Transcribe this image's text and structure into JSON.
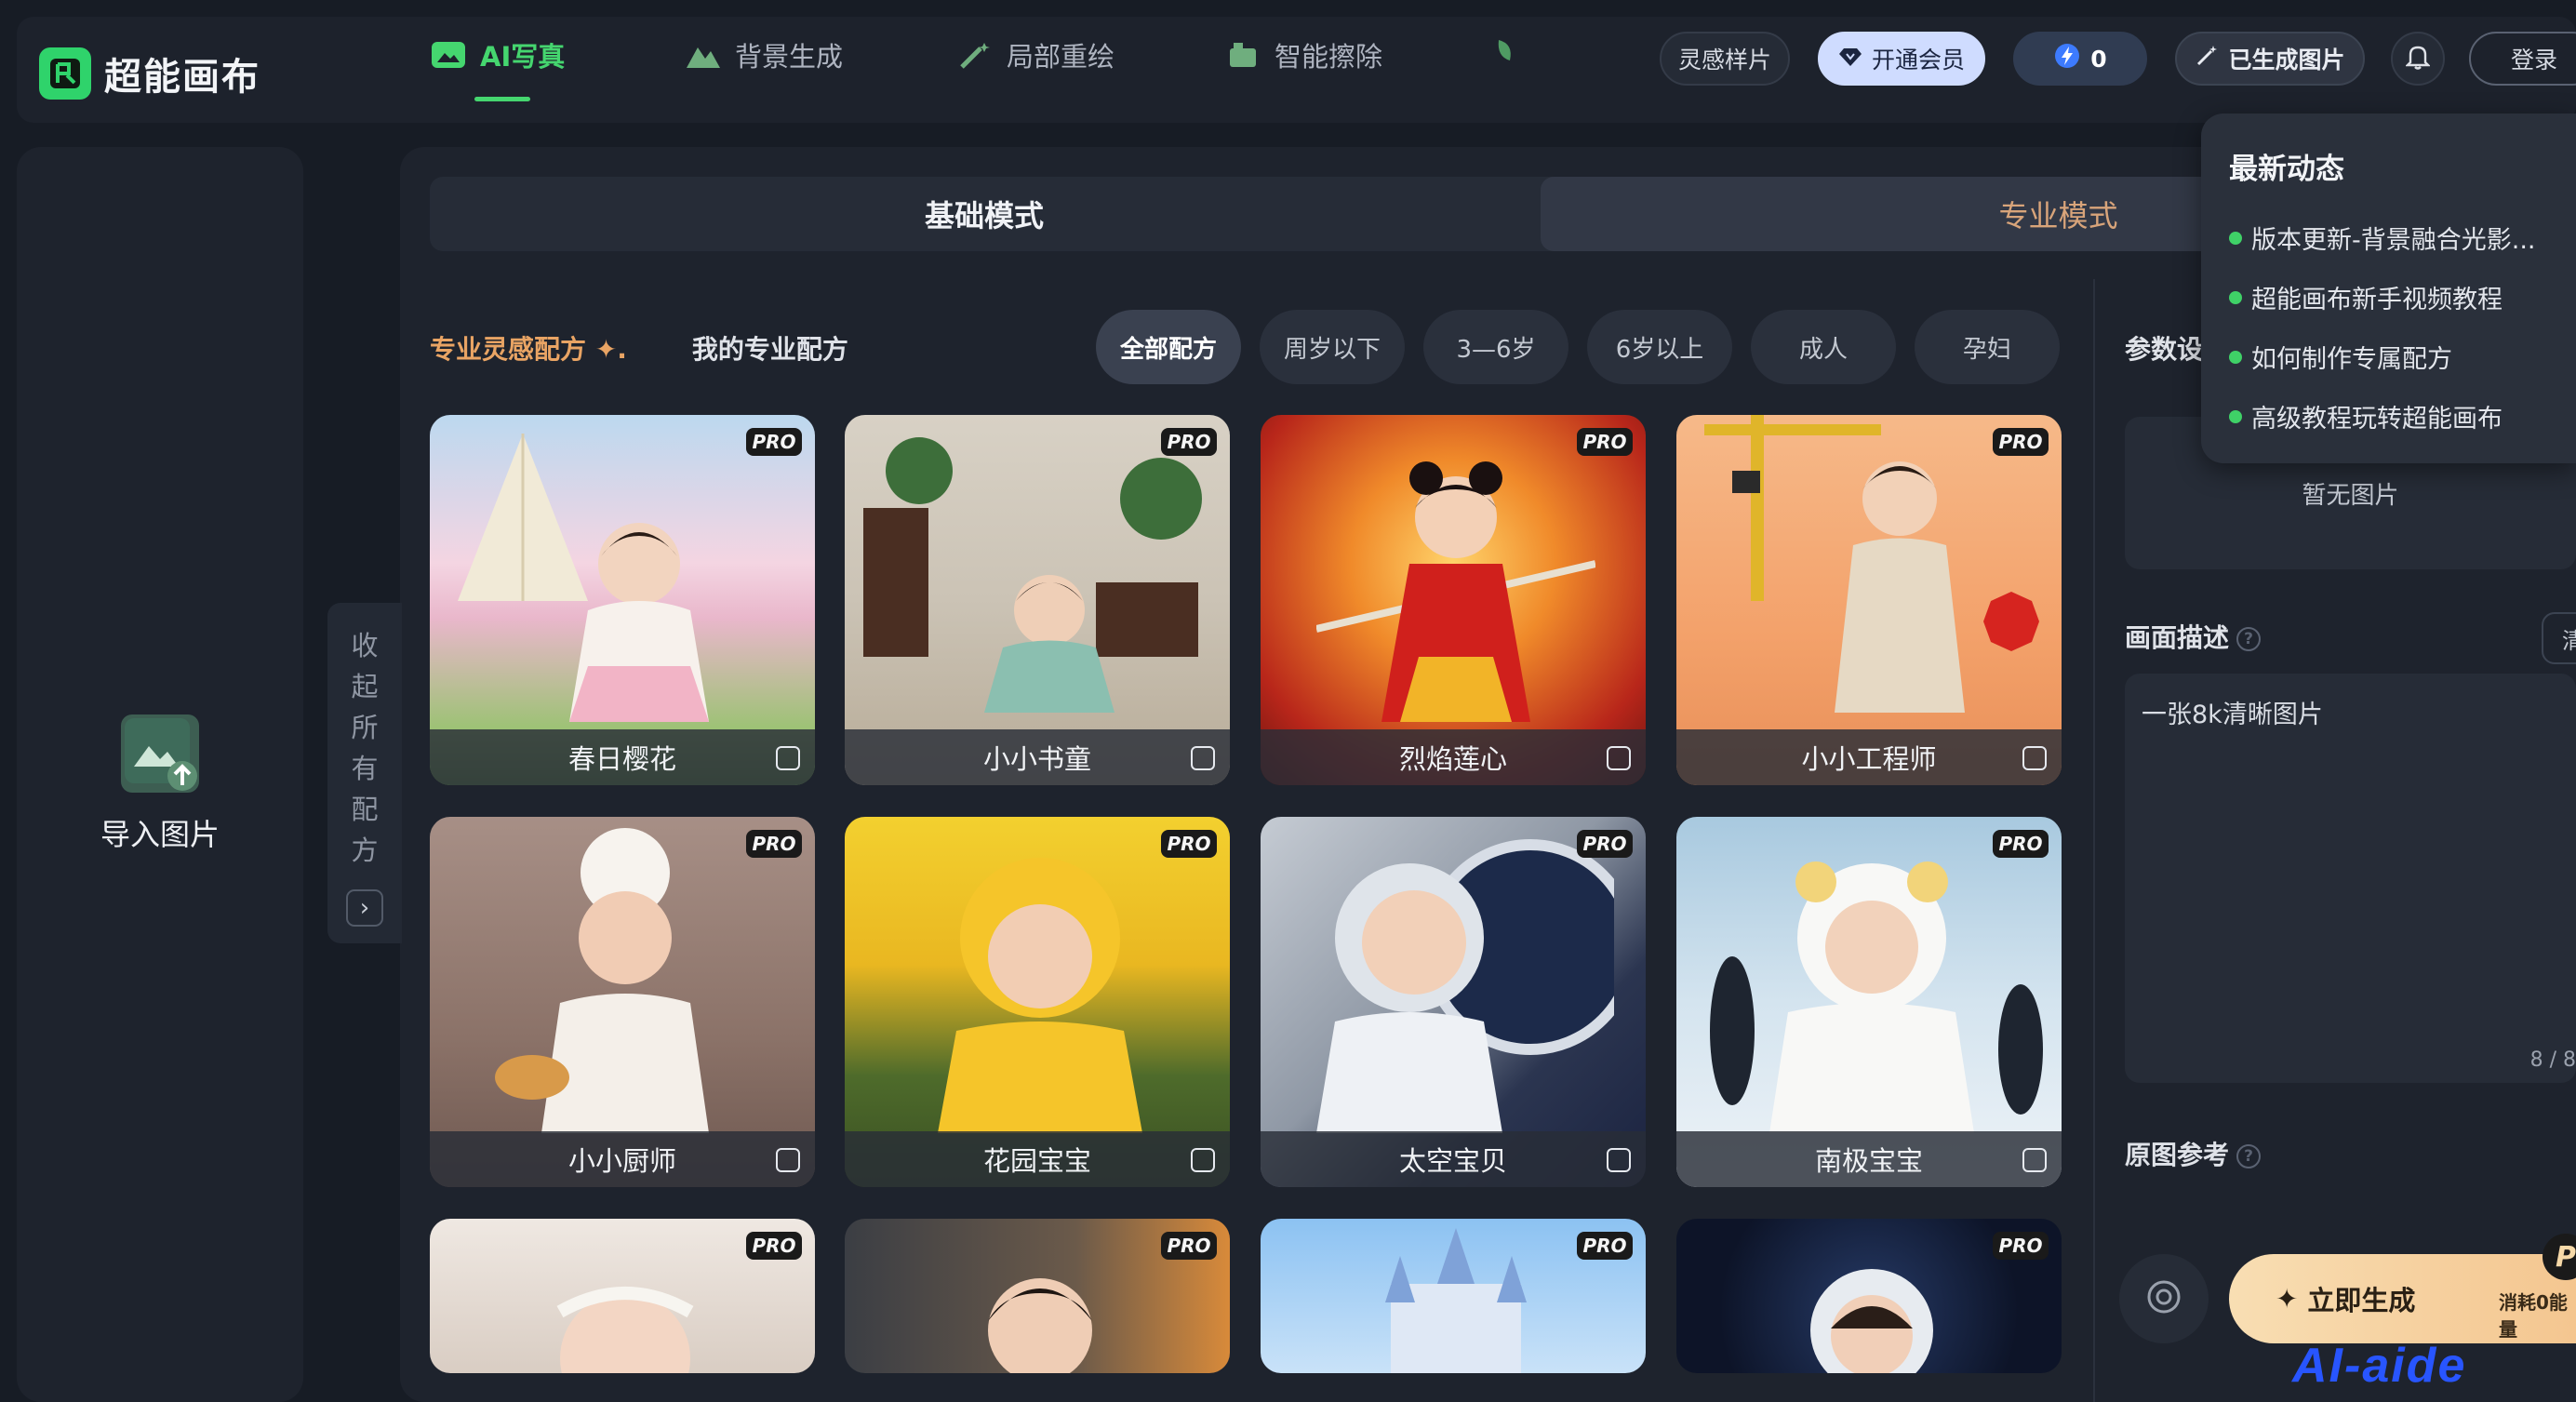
{
  "app": {
    "name": "超能画布"
  },
  "nav": {
    "tabs": [
      {
        "label": "AI写真",
        "active": true,
        "icon": "ai-photo-icon"
      },
      {
        "label": "背景生成",
        "active": false,
        "icon": "mountain-icon"
      },
      {
        "label": "局部重绘",
        "active": false,
        "icon": "magic-wand-icon"
      },
      {
        "label": "智能擦除",
        "active": false,
        "icon": "eraser-icon"
      }
    ],
    "inspiration": "灵感样片",
    "vip": "开通会员",
    "energy": "0",
    "generated": "已生成图片",
    "login": "登录"
  },
  "sidebar": {
    "import_label": "导入图片",
    "collapse_label": "收起所有配方"
  },
  "mode": {
    "basic": "基础模式",
    "pro": "专业模式"
  },
  "recipes": {
    "inspire_tab": "专业灵感配方",
    "mine_tab": "我的专业配方",
    "filters": [
      {
        "label": "全部配方",
        "active": true
      },
      {
        "label": "周岁以下",
        "active": false
      },
      {
        "label": "3—6岁",
        "active": false
      },
      {
        "label": "6岁以上",
        "active": false
      },
      {
        "label": "成人",
        "active": false
      },
      {
        "label": "孕妇",
        "active": false
      }
    ],
    "pro_badge": "PRO",
    "cards": [
      {
        "title": "春日樱花"
      },
      {
        "title": "小小书童"
      },
      {
        "title": "烈焰莲心"
      },
      {
        "title": "小小工程师"
      },
      {
        "title": "小小厨师"
      },
      {
        "title": "花园宝宝"
      },
      {
        "title": "太空宝贝"
      },
      {
        "title": "南极宝宝"
      }
    ]
  },
  "params": {
    "title": "参数设",
    "no_image": "暂无图片",
    "desc_label": "画面描述",
    "clear_label": "清",
    "desc_text": "一张8k清晰图片",
    "desc_count": "8 / 8",
    "ref_label": "原图参考",
    "generate_label": "立即生成",
    "generate_cost": "消耗0能量",
    "pro_badge": "P"
  },
  "news": {
    "title": "最新动态",
    "items": [
      "版本更新-背景融合光影...",
      "超能画布新手视频教程",
      "如何制作专属配方",
      "高级教程玩转超能画布"
    ]
  },
  "watermark": "AI-aide"
}
